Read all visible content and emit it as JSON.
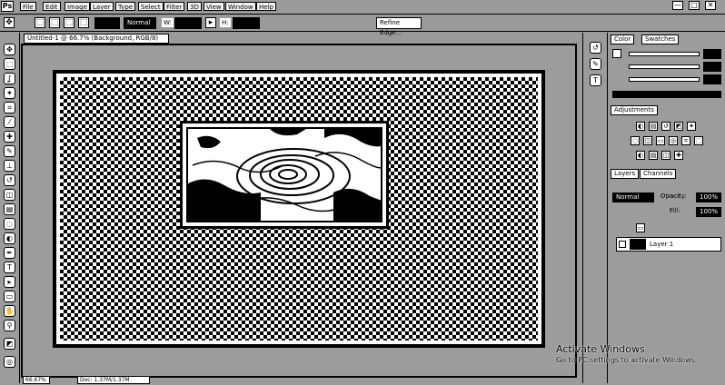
{
  "app": {
    "logo": "Ps"
  },
  "menu": [
    "File",
    "Edit",
    "Image",
    "Layer",
    "Type",
    "Select",
    "Filter",
    "3D",
    "View",
    "Window",
    "Help"
  ],
  "window_controls": {
    "minimize": "—",
    "maximize": "□",
    "close": "✕"
  },
  "options_bar": {
    "mode_value": "Normal",
    "width_label": "W:",
    "height_label": "H:",
    "refine_edge": "Refine Edge..."
  },
  "document": {
    "tab_title": "Untitled-1 @ 66.7% (Background, RGB/8)",
    "zoom": "66.67%",
    "info": "Doc: 1.37M/1.37M"
  },
  "panels": {
    "color_tab": "Color",
    "swatches_tab": "Swatches",
    "adjustments_tab": "Adjustments",
    "layers_tab": "Layers",
    "channels_tab": "Channels",
    "blend_mode": "Normal",
    "opacity_label": "Opacity:",
    "opacity_value": "100%",
    "fill_label": "Fill:",
    "fill_value": "100%",
    "layer_name": "Layer 1"
  },
  "watermark": {
    "title": "Activate Windows",
    "subtitle": "Go to PC settings to activate Windows."
  },
  "icons": {
    "move": "✥",
    "marquee": "⬚",
    "lasso": "ʆ",
    "wand": "✦",
    "crop": "⌗",
    "eyedropper": "⁄",
    "heal": "✚",
    "brush": "✎",
    "stamp": "⊥",
    "history": "↺",
    "eraser": "◫",
    "gradient": "▤",
    "blur": "◌",
    "dodge": "◐",
    "pen": "✒",
    "type": "T",
    "path": "▸",
    "shape": "▭",
    "hand": "✋",
    "zoom": "⚲",
    "fg_bg": "◩",
    "quickmask": "◎"
  }
}
